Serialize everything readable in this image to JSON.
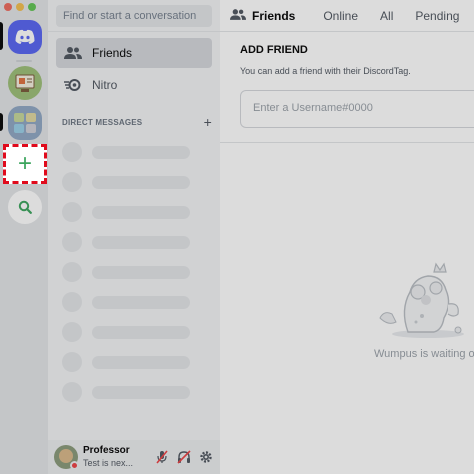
{
  "window": {
    "traffic_colors": [
      "#ed6a5e",
      "#f4bf4f",
      "#61c554"
    ]
  },
  "rail": {
    "home_icon": "discord-logo-icon",
    "servers": [
      {
        "name": "server-1",
        "icon": "server-avatar-icon"
      },
      {
        "name": "server-2",
        "icon": "server-avatar-icon"
      }
    ],
    "add_server_icon": "plus-icon",
    "add_server_symbol": "+",
    "explore_icon": "search-icon",
    "accent": "#5865f2",
    "add_color": "#3ba55d",
    "highlight_color": "#e00b1c"
  },
  "sidebar": {
    "search_placeholder": "Find or start a conversation",
    "items": [
      {
        "label": "Friends",
        "icon": "friends-icon"
      },
      {
        "label": "Nitro",
        "icon": "nitro-icon"
      }
    ],
    "dm_header": "DIRECT MESSAGES",
    "dm_add": "+"
  },
  "user": {
    "name": "Professor",
    "status_text": "Test is nex...",
    "status_color": "#ed4245",
    "controls": [
      "mute-microphone-icon",
      "deafen-icon",
      "settings-icon"
    ]
  },
  "main": {
    "title": "Friends",
    "tabs": [
      "Online",
      "All",
      "Pending"
    ],
    "add_friend_title": "ADD FRIEND",
    "add_friend_desc": "You can add a friend with their DiscordTag.",
    "username_placeholder": "Enter a Username#0000",
    "empty_state": "Wumpus is waiting o"
  }
}
